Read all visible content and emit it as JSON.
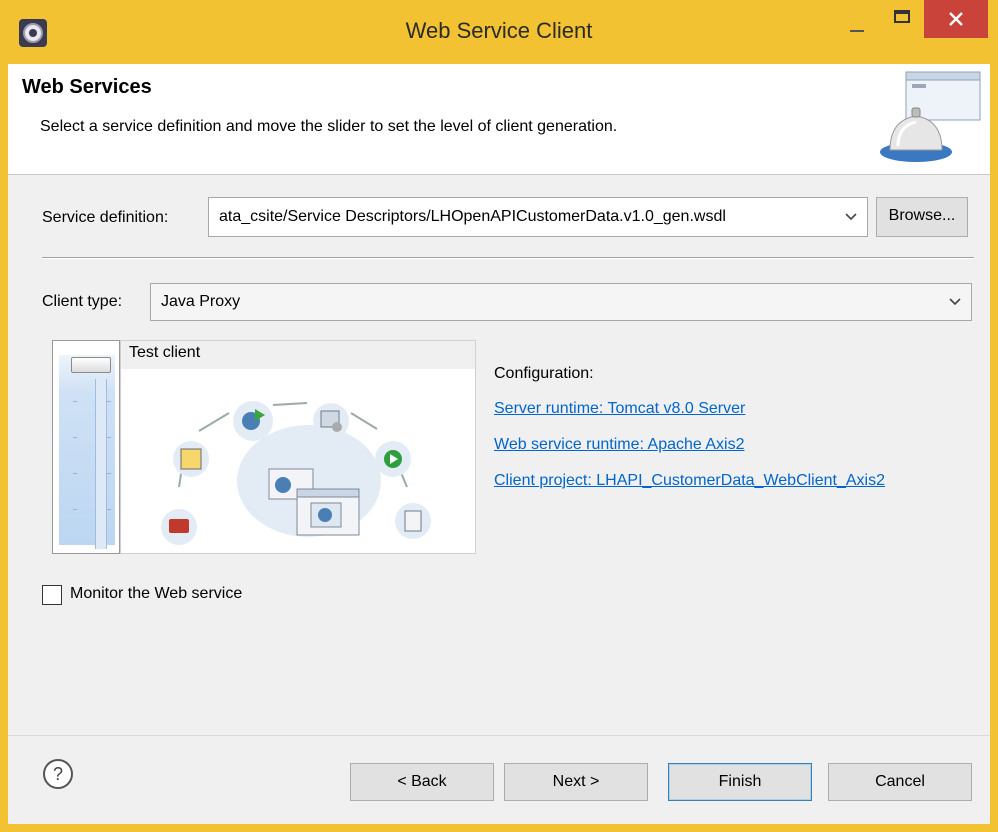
{
  "window": {
    "title": "Web Service Client"
  },
  "header": {
    "title": "Web Services",
    "description": "Select a service definition and move the slider to set the level of client generation."
  },
  "service_definition": {
    "label": "Service definition:",
    "value": "ata_csite/Service Descriptors/LHOpenAPICustomerData.v1.0_gen.wsdl",
    "browse_label": "Browse..."
  },
  "client_type": {
    "label": "Client type:",
    "value": "Java Proxy"
  },
  "slider": {
    "level_label": "Test client"
  },
  "configuration": {
    "label": "Configuration:",
    "server_runtime": "Server runtime: Tomcat v8.0 Server",
    "web_service_runtime": "Web service runtime: Apache Axis2",
    "client_project": "Client project: LHAPI_CustomerData_WebClient_Axis2"
  },
  "monitor": {
    "label": "Monitor the Web service",
    "checked": false
  },
  "buttons": {
    "back": "< Back",
    "next": "Next >",
    "finish": "Finish",
    "cancel": "Cancel"
  },
  "colors": {
    "frame": "#f2c233",
    "close": "#c9433a",
    "link": "#0066cc"
  }
}
